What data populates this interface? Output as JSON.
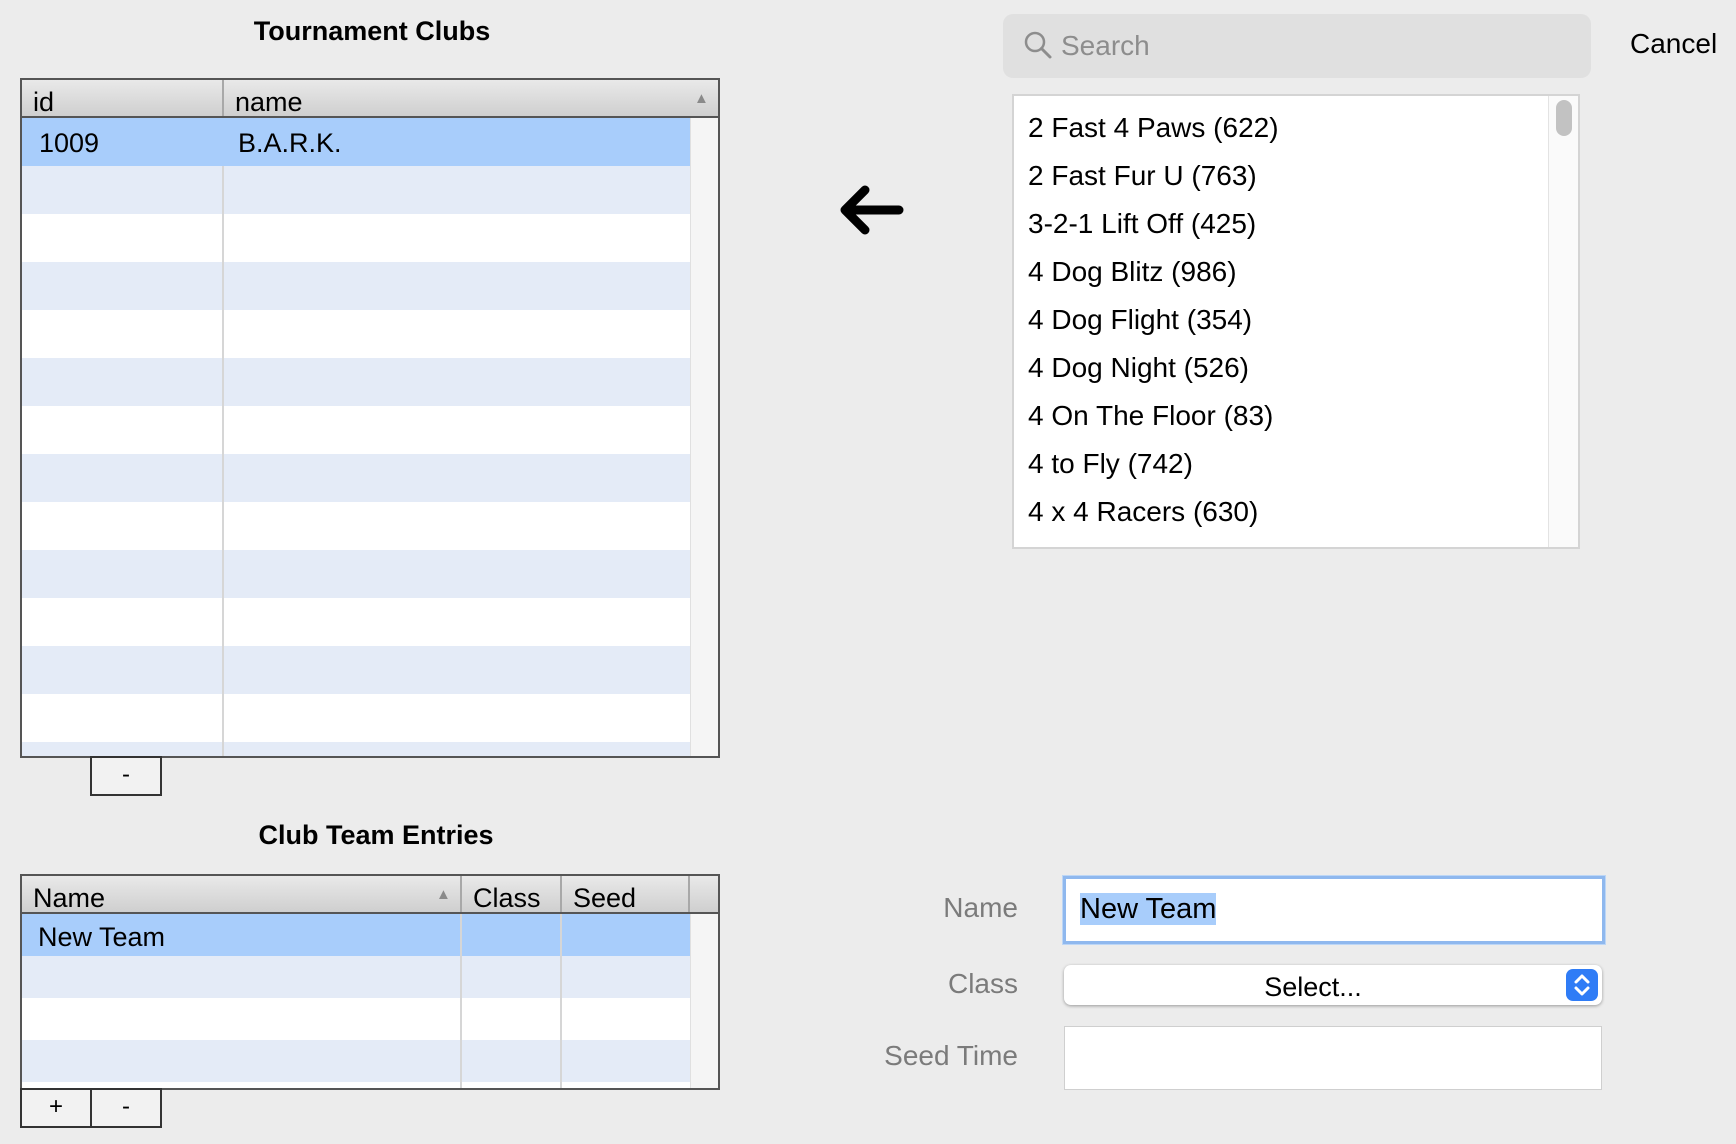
{
  "tournament_clubs": {
    "title": "Tournament Clubs",
    "columns": [
      "id",
      "name"
    ],
    "rows": [
      {
        "id": "1009",
        "name": "B.A.R.K."
      }
    ],
    "remove_label": "-"
  },
  "club_team_entries": {
    "title": "Club Team Entries",
    "columns": [
      "Name",
      "Class",
      "Seed"
    ],
    "rows": [
      {
        "name": "New Team",
        "class": "",
        "seed": ""
      }
    ],
    "add_label": "+",
    "remove_label": "-"
  },
  "search": {
    "placeholder": "Search",
    "cancel_label": "Cancel"
  },
  "club_list": [
    "2 Fast 4 Paws (622)",
    "2 Fast Fur U (763)",
    "3-2-1 Lift Off (425)",
    "4 Dog Blitz (986)",
    "4 Dog Flight (354)",
    "4 Dog Night (526)",
    "4 On The Floor (83)",
    "4 to Fly (742)",
    "4 x 4 Racers (630)"
  ],
  "form": {
    "name_label": "Name",
    "name_value": "New Team",
    "class_label": "Class",
    "class_value": "Select...",
    "seed_label": "Seed Time",
    "seed_value": ""
  },
  "icons": {
    "search": "search-icon",
    "arrow": "arrow-left-icon",
    "select": "chevron-up-down-icon"
  },
  "colors": {
    "selection": "#a8cdfb",
    "alt_row": "#e4ebf7",
    "accent": "#2f7cf6"
  }
}
